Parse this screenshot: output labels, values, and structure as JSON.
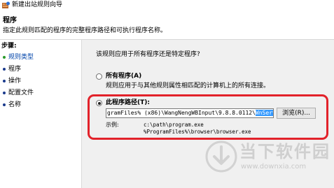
{
  "window": {
    "title": "新建出站规则向导"
  },
  "header": {
    "title": "程序",
    "description": "指定此规则匹配的程序的完整程序路径和可执行程序名称。"
  },
  "sidebar": {
    "steps_label": "步骤:",
    "items": [
      {
        "label": "规则类型",
        "state": "done"
      },
      {
        "label": "程序",
        "state": "active"
      },
      {
        "label": "操作",
        "state": "pending"
      },
      {
        "label": "配置文件",
        "state": "pending"
      },
      {
        "label": "名称",
        "state": "pending"
      }
    ]
  },
  "main": {
    "question": "该规则应用于所有程序还是特定程序?",
    "all_programs": {
      "label": "所有程序(A)",
      "description": "规则应用于与其他规则属性相匹配的计算机上的所有连接。",
      "checked": false
    },
    "this_program": {
      "label": "此程序路径(T):",
      "checked": true,
      "path_value_plain": "gramFiles% (x86)\\WangNengWBInput\\9.8.8.0112\\",
      "path_value_selected": "WnService.exe",
      "browse_label": "浏览(R)...",
      "example_label": "示例:",
      "example_lines": [
        "c:\\path\\program.exe",
        "%ProgramFiles%\\browser\\browser.exe"
      ]
    }
  },
  "watermark": {
    "text": "当下软件园",
    "url": "www.downxia.com"
  },
  "colors": {
    "highlight": "#e2222a",
    "selection": "#3399ff",
    "done_bullet": "#2a9a2a",
    "link": "#0044aa"
  }
}
